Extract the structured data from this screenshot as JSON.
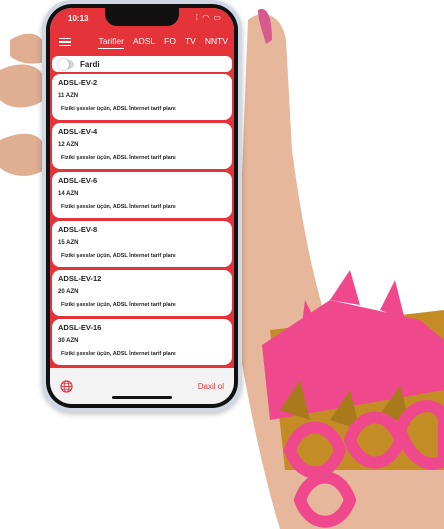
{
  "status": {
    "time": "10:13"
  },
  "nav": {
    "tabs": [
      "Tarifler",
      "ADSL",
      "FO",
      "TV",
      "NNTV"
    ],
    "active_tab": 0
  },
  "filter": {
    "label": "Fardi"
  },
  "plans": [
    {
      "name": "ADSL-EV-2",
      "price": "11 AZN",
      "desc": "Fiziki şəxslər üçün, ADSL İnternet tarif planı"
    },
    {
      "name": "ADSL-EV-4",
      "price": "12 AZN",
      "desc": "Fiziki şəxslər üçün, ADSL İnternet tarif planı"
    },
    {
      "name": "ADSL-EV-6",
      "price": "14 AZN",
      "desc": "Fiziki şəxslər üçün, ADSL İnternet tarif planı"
    },
    {
      "name": "ADSL-EV-8",
      "price": "15 AZN",
      "desc": "Fiziki şəxslər üçün, ADSL İnternet tarif planı"
    },
    {
      "name": "ADSL-EV-12",
      "price": "20 AZN",
      "desc": "Fiziki şəxslər üçün, ADSL İnternet tarif planı"
    },
    {
      "name": "ADSL-EV-16",
      "price": "30 AZN",
      "desc": "Fiziki şəxslər üçün, ADSL İnternet tarif planı"
    }
  ],
  "bottom": {
    "login_label": "Daxil ol"
  },
  "colors": {
    "accent": "#e43339",
    "bracelet": "#f0488c"
  },
  "icons": {
    "menu": "hamburger-icon",
    "globe": "globe-icon"
  }
}
